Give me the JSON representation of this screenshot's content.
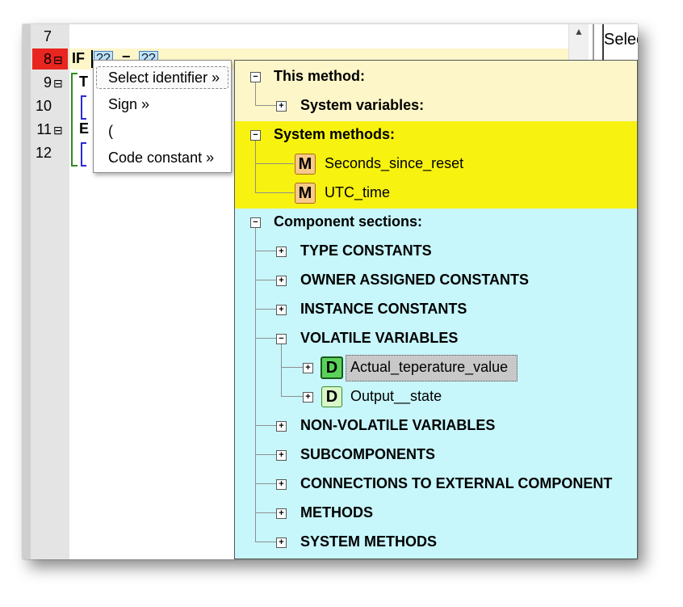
{
  "editor": {
    "line_numbers": [
      "7",
      "8",
      "9",
      "10",
      "11",
      "12"
    ],
    "fold_marker": "⊟",
    "if_keyword": "IF",
    "placeholder": "??",
    "equals": "=",
    "then_initial": "T",
    "else_initial": "E",
    "right_pane_text": "Selec"
  },
  "context_menu": {
    "items": [
      "Select identifier »",
      "Sign »",
      "(",
      "Code constant »"
    ]
  },
  "tree": {
    "this_method": {
      "label": "This method:",
      "children": [
        "System variables:"
      ]
    },
    "system_methods": {
      "label": "System methods:",
      "children": [
        "Seconds_since_reset",
        "UTC_time"
      ],
      "badge": "M"
    },
    "component_sections": {
      "label": "Component sections:",
      "children": [
        "TYPE CONSTANTS",
        "OWNER ASSIGNED CONSTANTS",
        "INSTANCE CONSTANTS",
        "VOLATILE VARIABLES",
        "NON-VOLATILE VARIABLES",
        "SUBCOMPONENTS",
        "CONNECTIONS TO EXTERNAL COMPONENT",
        "METHODS",
        "SYSTEM METHODS"
      ],
      "volatile_children": [
        "Actual_teperature_value",
        "Output__state"
      ],
      "badge": "D"
    },
    "expand_glyph": "+",
    "collapse_glyph": "−"
  },
  "colors": {
    "active_line": "#e8261f",
    "this_method_bg": "#fdf6c8",
    "system_methods_bg": "#f7f20f",
    "component_sections_bg": "#c7f6fb"
  }
}
